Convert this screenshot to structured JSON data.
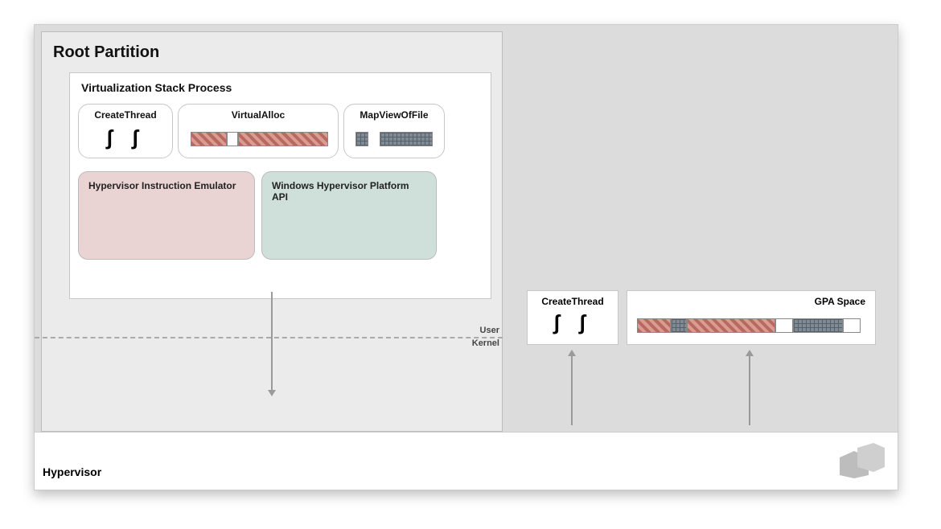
{
  "root_partition": {
    "title": "Root Partition"
  },
  "vstack": {
    "title": "Virtualization Stack Process",
    "createthread_label": "CreateThread",
    "virtualalloc_label": "VirtualAlloc",
    "mapviewoffile_label": "MapViewOfFile",
    "emulator_label": "Hypervisor Instruction Emulator",
    "platform_api_label": "Windows Hypervisor Platform API"
  },
  "boundary": {
    "user_label": "User",
    "kernel_label": "Kernel"
  },
  "right": {
    "createthread_label": "CreateThread",
    "gpa_label": "GPA Space"
  },
  "hypervisor": {
    "label": "Hypervisor"
  },
  "thread_icon_glyph": ") )"
}
